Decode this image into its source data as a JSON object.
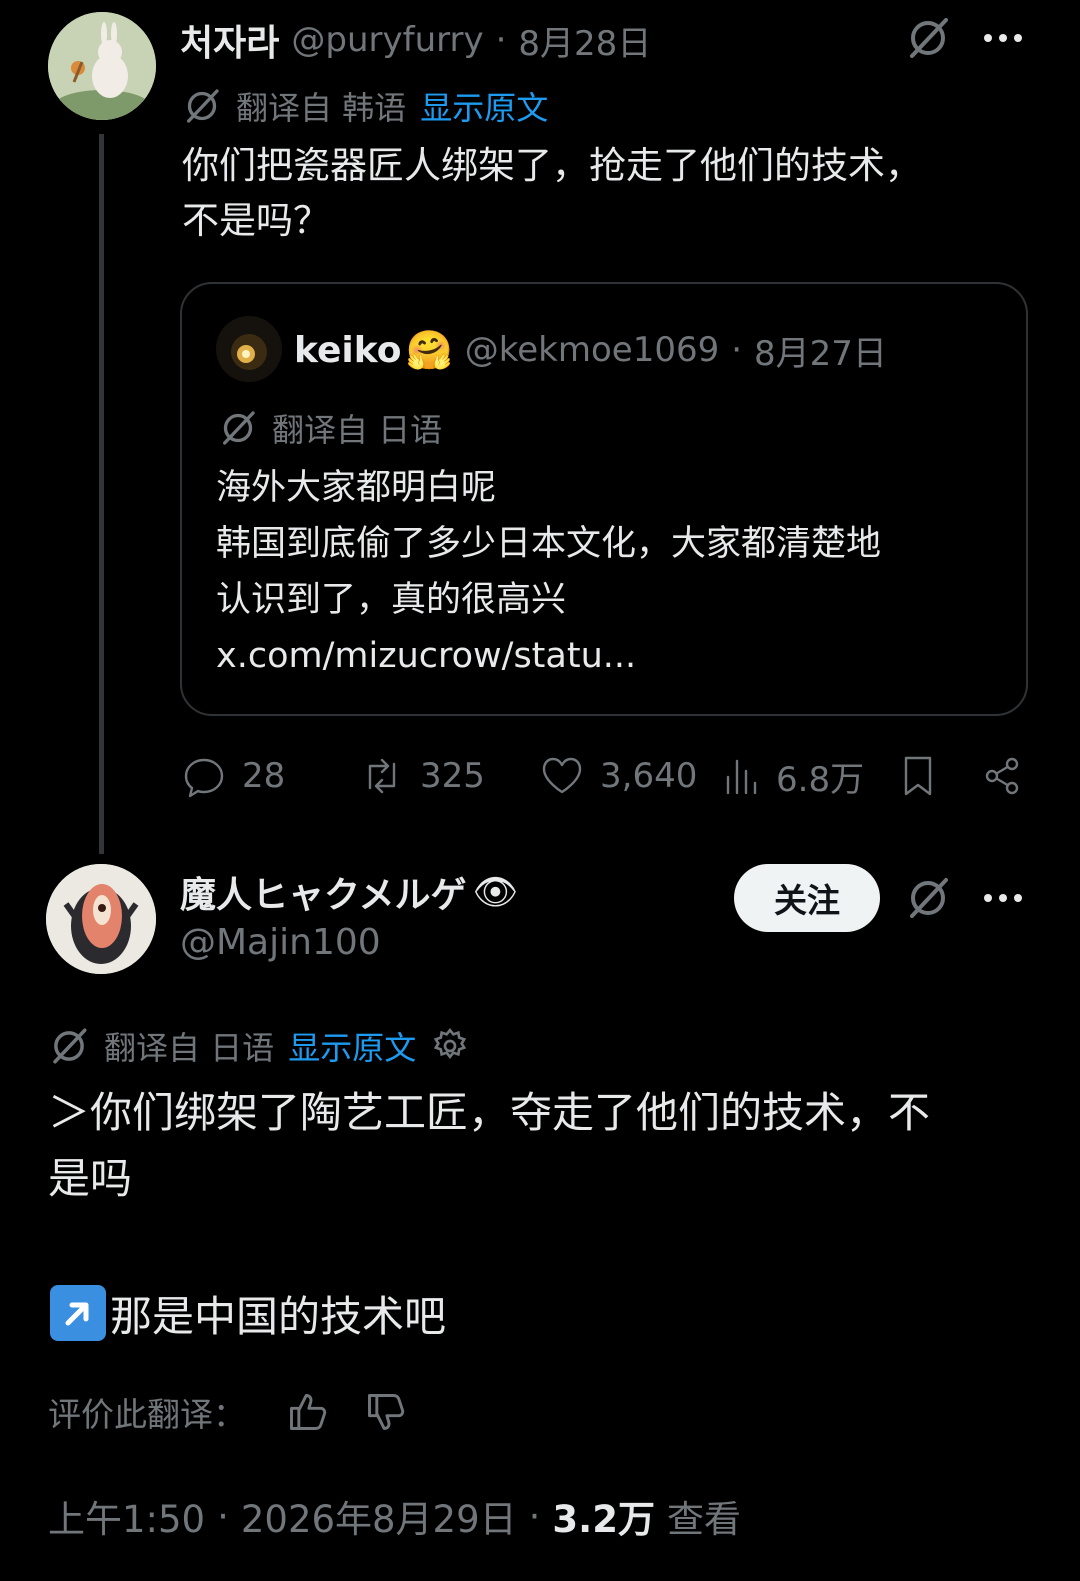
{
  "post1": {
    "display_name": "처자라",
    "handle": "@puryfurry",
    "sep": "·",
    "date": "8月28日",
    "translated_from": "翻译自 韩语",
    "show_original": "显示原文",
    "text_line1": "你们把瓷器匠人绑架了，抢走了他们的技术，",
    "text_line2": "不是吗？",
    "quote": {
      "display_name": "keiko",
      "emoji": "🤗",
      "handle": "@kekmoe1069",
      "sep": "·",
      "date": "8月27日",
      "translated_from": "翻译自 日语",
      "line1": "海外大家都明白呢",
      "line2": "韩国到底偷了多少日本文化，大家都清楚地",
      "line3": "认识到了，真的很高兴",
      "line4": "x.com/mizucrow/statu..."
    },
    "stats": {
      "replies": "28",
      "reposts": "325",
      "likes": "3,640",
      "views": "6.8万"
    }
  },
  "post2": {
    "display_name": "魔人ヒャクメルゲ",
    "emoji": "👁",
    "handle": "@Majin100",
    "follow_label": "关注",
    "translated_from": "翻译自 日语",
    "show_original": "显示原文",
    "text_line1": "＞你们绑架了陶艺工匠，夺走了他们的技术，不",
    "text_line2": "是吗",
    "text_line3": "那是中国的技术吧",
    "rate_label": "评价此翻译：",
    "time": "上午1:50",
    "sep1": "·",
    "date": "2026年8月29日",
    "sep2": "·",
    "views_count": "3.2万",
    "views_label": "查看"
  },
  "icons": [
    "grok-icon",
    "more-icon",
    "reply-icon",
    "repost-icon",
    "like-icon",
    "views-icon",
    "bookmark-icon",
    "share-icon",
    "settings-icon",
    "thumbs-up-icon",
    "thumbs-down-icon",
    "arrow-up-right-icon"
  ]
}
